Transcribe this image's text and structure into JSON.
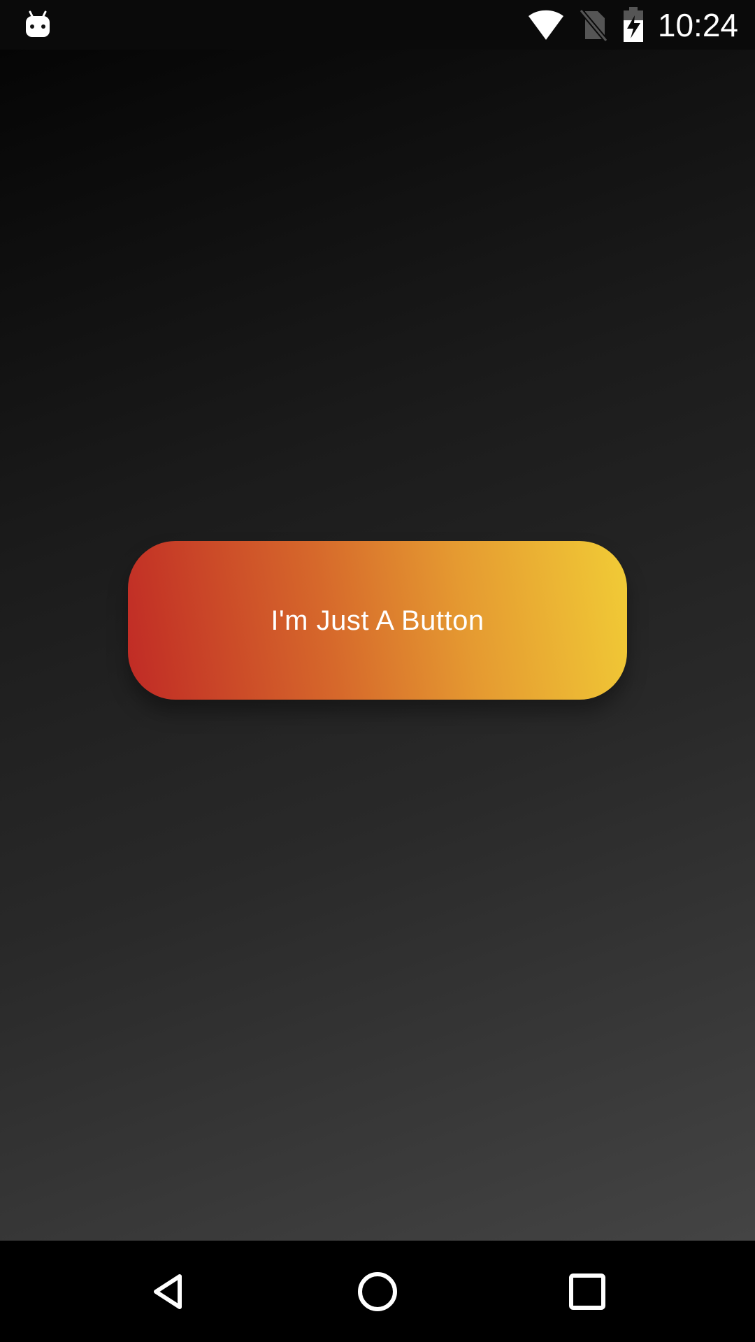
{
  "status_bar": {
    "time": "10:24",
    "left_icon": "android-notification-icon",
    "right_icons": [
      "wifi-icon",
      "no-sim-icon",
      "battery-charging-icon"
    ]
  },
  "main": {
    "button_label": "I'm Just A Button",
    "button_gradient": [
      "#c02a25",
      "#d6682b",
      "#e59a31",
      "#f1cc36"
    ],
    "background_gradient": [
      "#050505",
      "#1b1b1b",
      "#292929",
      "#444444"
    ]
  },
  "navigation": {
    "buttons": [
      "back-icon",
      "home-icon",
      "recents-icon"
    ]
  }
}
